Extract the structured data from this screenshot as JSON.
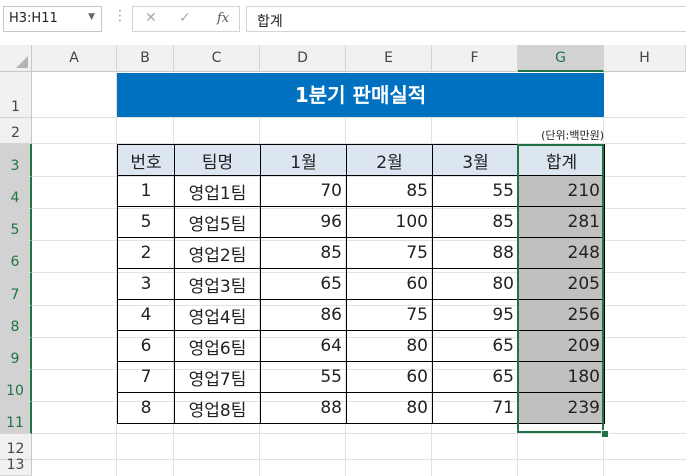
{
  "name_box": "H3:H11",
  "formula": "합계",
  "columns": [
    "A",
    "B",
    "C",
    "D",
    "E",
    "F",
    "G",
    "H"
  ],
  "rows": [
    "1",
    "2",
    "3",
    "4",
    "5",
    "6",
    "7",
    "8",
    "9",
    "10",
    "11",
    "12",
    "13"
  ],
  "title": "1분기 판매실적",
  "unit_note": "(단위:백만원)",
  "table": {
    "headers": [
      "번호",
      "팀명",
      "1월",
      "2월",
      "3월",
      "합계"
    ],
    "rows": [
      [
        "1",
        "영업1팀",
        "70",
        "85",
        "55",
        "210"
      ],
      [
        "5",
        "영업5팀",
        "96",
        "100",
        "85",
        "281"
      ],
      [
        "2",
        "영업2팀",
        "85",
        "75",
        "88",
        "248"
      ],
      [
        "3",
        "영업3팀",
        "65",
        "60",
        "80",
        "205"
      ],
      [
        "4",
        "영업4팀",
        "86",
        "75",
        "95",
        "256"
      ],
      [
        "6",
        "영업6팀",
        "64",
        "80",
        "65",
        "209"
      ],
      [
        "7",
        "영업7팀",
        "55",
        "60",
        "65",
        "180"
      ],
      [
        "8",
        "영업8팀",
        "88",
        "80",
        "71",
        "239"
      ]
    ]
  },
  "colors": {
    "title_bg": "#0070c0",
    "header_bg": "#dce6f1",
    "total_bg": "#c0c0c0",
    "selection": "#217346"
  },
  "icons": {
    "cancel": "✕",
    "enter": "✓",
    "function": "fx"
  }
}
